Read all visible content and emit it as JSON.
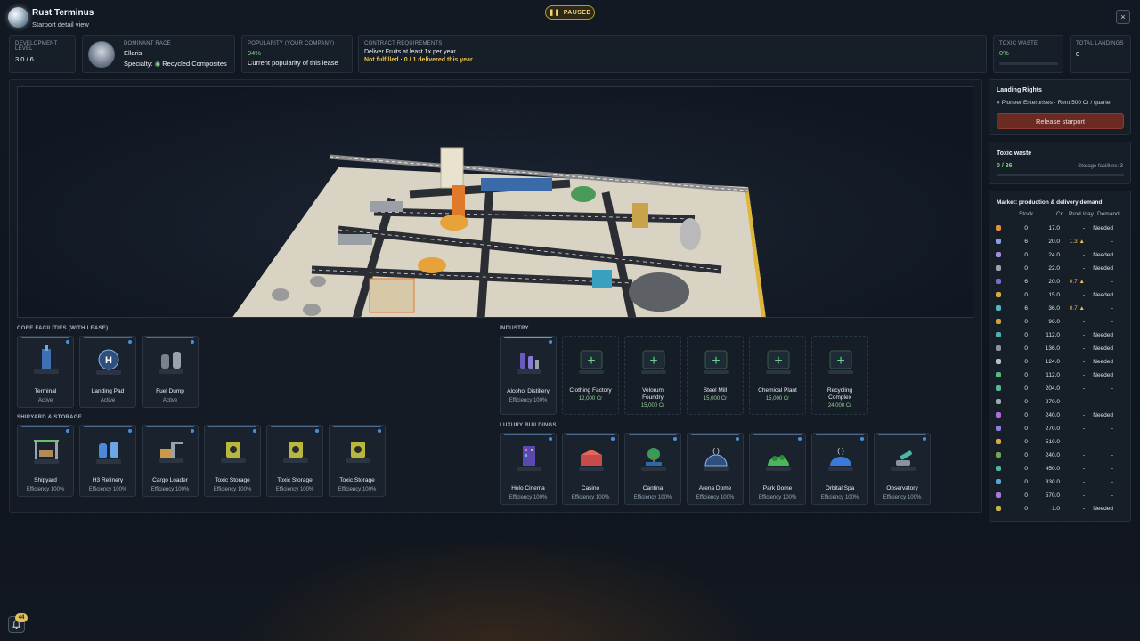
{
  "header": {
    "title": "Rust Terminus",
    "subtitle": "Starport detail view",
    "paused_label": "PAUSED",
    "close_label": "×"
  },
  "stats": {
    "development_label": "DEVELOPMENT LEVEL",
    "development_value": "3.0 / 6",
    "race_label": "DOMINANT RACE",
    "race_value": "Ellaris",
    "race_specialty_label": "Specialty:",
    "race_specialty_value": "Recycled Composites",
    "popularity_label": "POPULARITY (YOUR COMPANY)",
    "popularity_value": "94%",
    "popularity_note": "Current popularity of this lease",
    "contract_label": "CONTRACT REQUIREMENTS",
    "contract_text": "Deliver Fruits at least 1x per year",
    "contract_status": "Not fulfilled · 0 / 1 delivered this year",
    "toxic_label": "TOXIC WASTE",
    "toxic_value": "0%",
    "toxic_fraction": 0,
    "landings_label": "TOTAL LANDINGS",
    "landings_value": "0"
  },
  "sections": {
    "core": "CORE FACILITIES (WITH LEASE)",
    "shipyard": "SHIPYARD & STORAGE",
    "industry": "INDUSTRY",
    "luxury": "LUXURY BUILDINGS"
  },
  "core_facilities": [
    {
      "name": "Terminal",
      "status": "Active"
    },
    {
      "name": "Landing Pad",
      "status": "Active"
    },
    {
      "name": "Fuel Dump",
      "status": "Active"
    }
  ],
  "shipyard_storage": [
    {
      "name": "Shipyard",
      "status": "Efficiency 100%"
    },
    {
      "name": "H3 Refinery",
      "status": "Efficiency 100%"
    },
    {
      "name": "Cargo Loader",
      "status": "Efficiency 100%"
    },
    {
      "name": "Toxic Storage",
      "status": "Efficiency 100%"
    },
    {
      "name": "Toxic Storage",
      "status": "Efficiency 100%"
    },
    {
      "name": "Toxic Storage",
      "status": "Efficiency 100%"
    }
  ],
  "industry": [
    {
      "name": "Alcohol Distillery",
      "status": "Efficiency 100%"
    },
    {
      "name": "Clothing Factory",
      "status": "12,000 Cr"
    },
    {
      "name": "Velorum Foundry",
      "status": "15,000 Cr"
    },
    {
      "name": "Steel Mill",
      "status": "15,000 Cr"
    },
    {
      "name": "Chemical Plant",
      "status": "15,000 Cr"
    },
    {
      "name": "Recycling Complex",
      "status": "24,000 Cr"
    }
  ],
  "luxury": [
    {
      "name": "Holo Cinema",
      "status": "Efficiency 100%"
    },
    {
      "name": "Casino",
      "status": "Efficiency 100%"
    },
    {
      "name": "Cantina",
      "status": "Efficiency 100%"
    },
    {
      "name": "Arena Dome",
      "status": "Efficiency 100%"
    },
    {
      "name": "Park Dome",
      "status": "Efficiency 100%"
    },
    {
      "name": "Orbital Spa",
      "status": "Efficiency 100%"
    },
    {
      "name": "Observatory",
      "status": "Efficiency 100%"
    }
  ],
  "landing_rights": {
    "title": "Landing Rights",
    "text": "Pioneer Enterprises · Rent 500 Cr / quarter",
    "button": "Release starport"
  },
  "toxic_waste": {
    "title": "Toxic waste",
    "value": "0 / 36",
    "fraction": 0,
    "facilities": "Storage facilities: 3"
  },
  "market": {
    "title": "Market: production & delivery demand",
    "headers": [
      "Stock",
      "Cr",
      "Prod./day",
      "Demand"
    ],
    "rows": [
      {
        "color": "#e0903a",
        "stock": "0",
        "cr": "17.0",
        "prod": "-",
        "demand": "Needed"
      },
      {
        "color": "#8a9ee8",
        "stock": "6",
        "cr": "20.0",
        "prod": "1.3 ▲",
        "demand": "-"
      },
      {
        "color": "#a78ae0",
        "stock": "0",
        "cr": "24.0",
        "prod": "-",
        "demand": "Needed"
      },
      {
        "color": "#9aa3ad",
        "stock": "0",
        "cr": "22.0",
        "prod": "-",
        "demand": "Needed"
      },
      {
        "color": "#7a6ad0",
        "stock": "6",
        "cr": "20.0",
        "prod": "0.7 ▲",
        "demand": "-"
      },
      {
        "color": "#d9a83a",
        "stock": "0",
        "cr": "15.0",
        "prod": "-",
        "demand": "Needed"
      },
      {
        "color": "#4fb6c6",
        "stock": "6",
        "cr": "36.0",
        "prod": "0.7 ▲",
        "demand": "-"
      },
      {
        "color": "#d0a23c",
        "stock": "0",
        "cr": "96.0",
        "prod": "-",
        "demand": "-"
      },
      {
        "color": "#49b0b4",
        "stock": "0",
        "cr": "112.0",
        "prod": "-",
        "demand": "Needed"
      },
      {
        "color": "#8a92a0",
        "stock": "0",
        "cr": "136.0",
        "prod": "-",
        "demand": "Needed"
      },
      {
        "color": "#b8c0ca",
        "stock": "0",
        "cr": "124.0",
        "prod": "-",
        "demand": "Needed"
      },
      {
        "color": "#5ab87a",
        "stock": "0",
        "cr": "112.0",
        "prod": "-",
        "demand": "Needed"
      },
      {
        "color": "#54b890",
        "stock": "0",
        "cr": "204.0",
        "prod": "-",
        "demand": "-"
      },
      {
        "color": "#a0a8b4",
        "stock": "0",
        "cr": "270.0",
        "prod": "-",
        "demand": "-"
      },
      {
        "color": "#b56ad8",
        "stock": "0",
        "cr": "240.0",
        "prod": "-",
        "demand": "Needed"
      },
      {
        "color": "#8a7ee0",
        "stock": "0",
        "cr": "270.0",
        "prod": "-",
        "demand": "-"
      },
      {
        "color": "#d8a84a",
        "stock": "0",
        "cr": "510.0",
        "prod": "-",
        "demand": "-"
      },
      {
        "color": "#6aa85a",
        "stock": "0",
        "cr": "240.0",
        "prod": "-",
        "demand": "-"
      },
      {
        "color": "#4ab89a",
        "stock": "0",
        "cr": "450.0",
        "prod": "-",
        "demand": "-"
      },
      {
        "color": "#58a6d8",
        "stock": "0",
        "cr": "330.0",
        "prod": "-",
        "demand": "-"
      },
      {
        "color": "#a47ad8",
        "stock": "0",
        "cr": "570.0",
        "prod": "-",
        "demand": "-"
      },
      {
        "color": "#c8b048",
        "stock": "0",
        "cr": "1.0",
        "prod": "-",
        "demand": "Needed"
      }
    ]
  },
  "notifications": {
    "count": "44"
  }
}
